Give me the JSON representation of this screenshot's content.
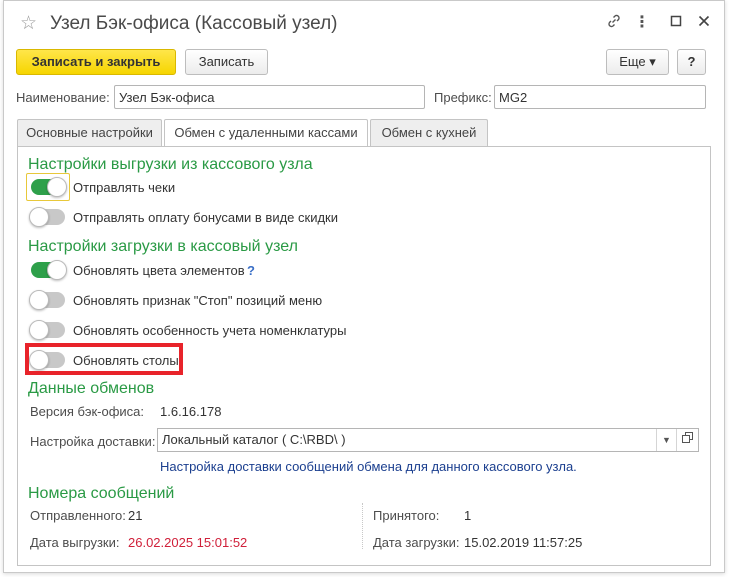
{
  "window": {
    "title": "Узел Бэк-офиса (Кассовый узел)",
    "icons": {
      "favorite": "star-icon",
      "link": "link-icon",
      "menu": "more-icon",
      "maximize": "maximize-icon",
      "close": "close-icon"
    }
  },
  "toolbar": {
    "save_close_label": "Записать и закрыть",
    "save_label": "Записать",
    "more_label": "Еще ▾",
    "help_label": "?"
  },
  "form": {
    "name_label": "Наименование:",
    "name_value": "Узел Бэк-офиса",
    "prefix_label": "Префикс:",
    "prefix_value": "MG2"
  },
  "tabs": [
    {
      "label": "Основные настройки",
      "active": false
    },
    {
      "label": "Обмен с удаленными кассами",
      "active": true
    },
    {
      "label": "Обмен с кухней",
      "active": false
    }
  ],
  "upload_section": {
    "title": "Настройки выгрузки из кассового узла",
    "items": [
      {
        "label": "Отправлять чеки",
        "on": true
      },
      {
        "label": "Отправлять оплату бонусами в виде скидки",
        "on": false
      }
    ]
  },
  "download_section": {
    "title": "Настройки загрузки в кассовый узел",
    "items": [
      {
        "label": "Обновлять цвета элементов",
        "on": true,
        "help": "?"
      },
      {
        "label": "Обновлять признак \"Стоп\" позиций меню",
        "on": false
      },
      {
        "label": "Обновлять особенность учета номенклатуры",
        "on": false
      },
      {
        "label": "Обновлять столы",
        "on": false
      }
    ]
  },
  "exchange_section": {
    "title": "Данные обменов",
    "version_label": "Версия бэк-офиса:",
    "version_value": "1.6.16.178",
    "delivery_label": "Настройка доставки:",
    "delivery_value": "Локальный каталог ( C:\\RBD\\ )",
    "delivery_link": "Настройка доставки сообщений обмена для данного кассового узла."
  },
  "messages_section": {
    "title": "Номера сообщений",
    "sent_label": "Отправленного:",
    "sent_value": "21",
    "received_label": "Принятого:",
    "received_value": "1",
    "upload_date_label": "Дата выгрузки:",
    "upload_date_value": "26.02.2025 15:01:52",
    "download_date_label": "Дата загрузки:",
    "download_date_value": "15.02.2019 11:57:25"
  },
  "colors": {
    "accent_green": "#2a9a45",
    "toggle_on": "#2ea04a",
    "primary_button": "#f6d500",
    "highlight_red": "#e8232a",
    "date_red": "#d0203a"
  }
}
